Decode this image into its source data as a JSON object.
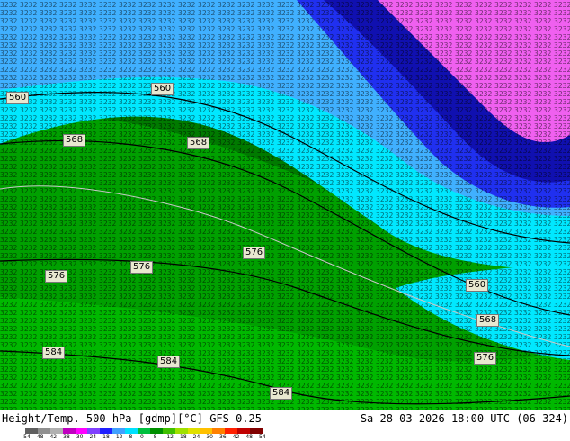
{
  "title": "Height/Temp. 500 hPa [gdmp][°C] GFS 0.25",
  "run_info": "Sa 28-03-2026 18:00 UTC (06+324)",
  "contour_labels": [
    "560",
    "560",
    "568",
    "568",
    "576",
    "576",
    "576",
    "560",
    "568",
    "576",
    "584",
    "584",
    "584"
  ],
  "colorbar": {
    "ticks": [
      "-54",
      "-48",
      "-42",
      "-38",
      "-30",
      "-24",
      "-18",
      "-12",
      "-8",
      "0",
      "8",
      "12",
      "18",
      "24",
      "30",
      "36",
      "42",
      "48",
      "54"
    ],
    "colors": [
      "#606060",
      "#909090",
      "#b0b0b0",
      "#c000c0",
      "#ff00ff",
      "#8040ff",
      "#2020ff",
      "#40a0ff",
      "#00e0ff",
      "#00c040",
      "#009000",
      "#40c000",
      "#a0e000",
      "#e0e000",
      "#ffc000",
      "#ff8000",
      "#ff2000",
      "#c00000",
      "#800000"
    ]
  },
  "colors": {
    "dark_green": "#007a00",
    "green": "#00a000",
    "light_green": "#00b800",
    "cyan": "#00e8ff",
    "sky_blue": "#40b0ff",
    "blue": "#2030f0",
    "dark_blue": "#1010b0",
    "magenta": "#f060f0"
  },
  "legend_icon": "color-scale-bar"
}
